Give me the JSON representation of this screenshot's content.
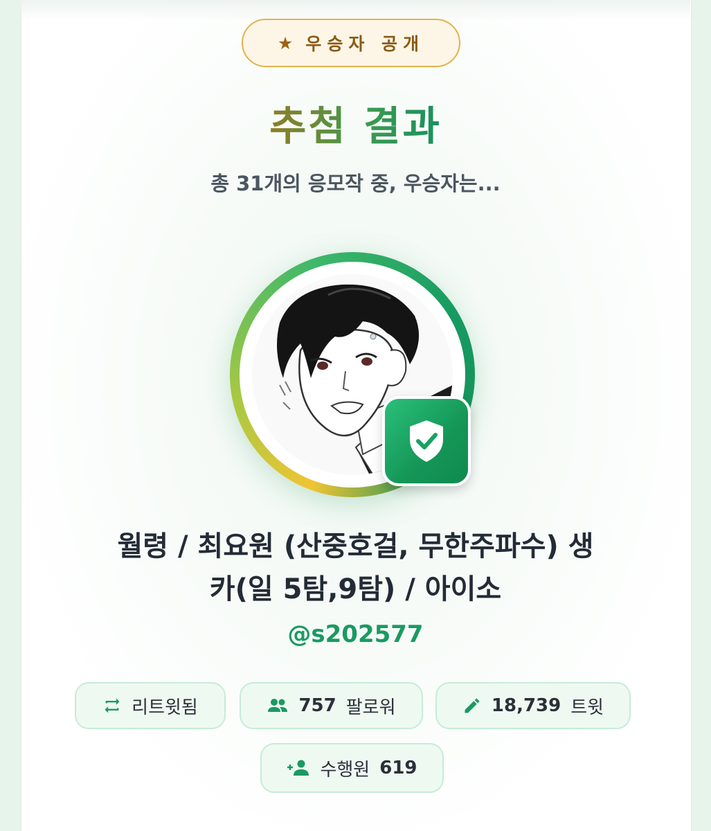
{
  "badge": {
    "icon": "star-icon",
    "label": "우승자 공개"
  },
  "result": {
    "title": "추첨 결과",
    "subtitle": "총 31개의 응모작 중, 우승자는..."
  },
  "winner": {
    "avatar": "winner-avatar-sketch",
    "verified_icon": "verified-shield-icon",
    "title_line1": "월령 / 최요원 (산중호걸, 무한주파수) 생",
    "title_line2": "카(일 5탐,9탐) / 아이소",
    "handle": "@s202577"
  },
  "stats": {
    "retweet": {
      "icon": "retweet-icon",
      "label": "리트윗됨"
    },
    "followers": {
      "icon": "people-icon",
      "value": "757",
      "label": "팔로워"
    },
    "tweets": {
      "icon": "pencil-icon",
      "value": "18,739",
      "label": "트윗"
    },
    "following": {
      "icon": "person-add-icon",
      "label": "수행원",
      "value": "619"
    }
  },
  "colors": {
    "accent_green": "#1a9a63",
    "badge_gold": "#e2b24a",
    "stat_bg": "#eef9f2"
  }
}
